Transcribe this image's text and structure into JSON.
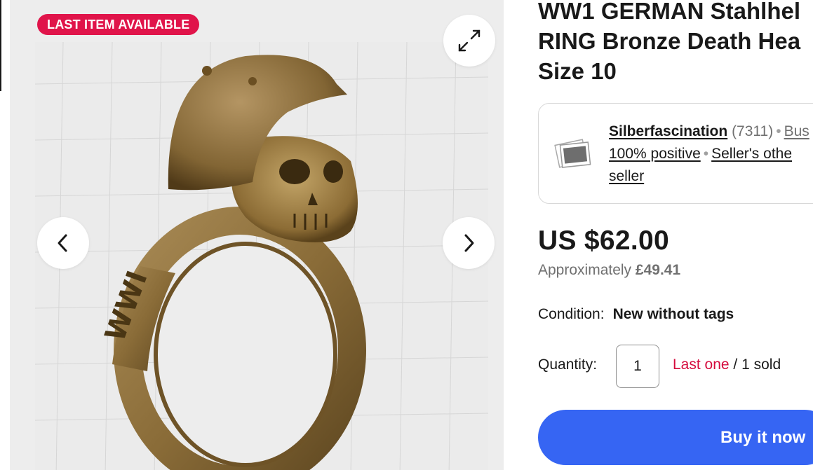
{
  "gallery": {
    "badge": "LAST ITEM AVAILABLE",
    "expand_icon": "expand-arrows-icon",
    "prev_icon": "chevron-left-icon",
    "next_icon": "chevron-right-icon"
  },
  "listing": {
    "title_lines": [
      "WW1 GERMAN Stahlhel",
      "RING Bronze Death Hea",
      "Size 10"
    ],
    "price": "US $62.00",
    "approx_prefix": "Approximately",
    "approx_value": "£49.41",
    "condition_label": "Condition:",
    "condition_value": "New without tags",
    "quantity_label": "Quantity:",
    "quantity_value": "1",
    "last_one": "Last one",
    "sold_text": " / 1 sold",
    "buy_label": "Buy it now"
  },
  "seller": {
    "name": "Silberfascination",
    "feedback_count": "(7311)",
    "type": "Bus",
    "positive": "100% positive",
    "other_items": "Seller's othe",
    "other_items_cont": "seller",
    "avatar_icon": "photo-stack-icon"
  },
  "colors": {
    "badge_bg": "#e0144a",
    "buy_button": "#3665f3",
    "last_one": "#d50b3d"
  }
}
